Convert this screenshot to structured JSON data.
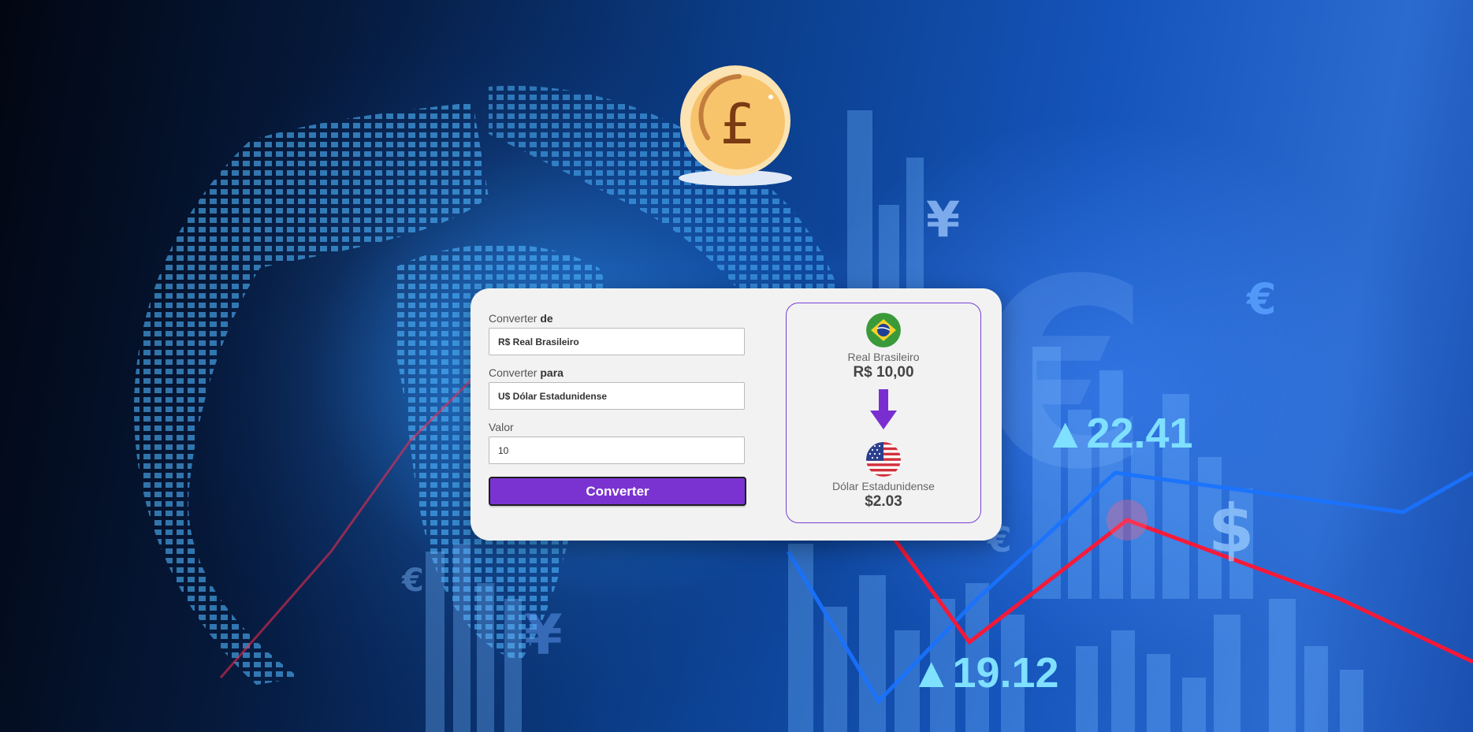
{
  "form": {
    "from_label_prefix": "Converter",
    "from_label_bold": "de",
    "from_value": "R$ Real Brasileiro",
    "to_label_prefix": "Converter",
    "to_label_bold": "para",
    "to_value": "U$ Dólar Estadunidense",
    "amount_label": "Valor",
    "amount_value": "10",
    "convert_label": "Converter"
  },
  "result": {
    "from_currency_name": "Real Brasileiro",
    "from_currency_value": "R$ 10,00",
    "to_currency_name": "Dólar Estadunidense",
    "to_currency_value": "$2.03",
    "from_flag_icon": "brazil-flag-icon",
    "to_flag_icon": "usa-flag-icon",
    "arrow_icon": "arrow-down-icon"
  },
  "background": {
    "ticker_1": "▲22.41",
    "ticker_2": "▲19.12",
    "symbols": [
      "¥",
      "€",
      "$",
      "€",
      "€",
      "¥"
    ]
  },
  "colors": {
    "accent": "#7a33d1",
    "card_bg": "#f2f2f2",
    "result_border": "#7a3fd4"
  }
}
